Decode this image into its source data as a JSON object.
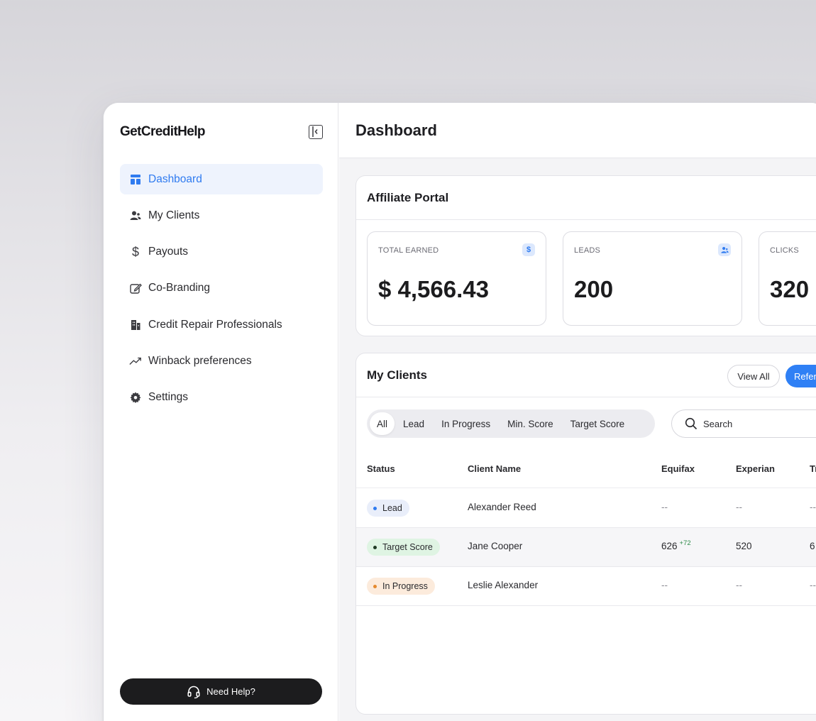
{
  "sidebar": {
    "logo": "GetCreditHelp",
    "items": [
      {
        "label": "Dashboard",
        "icon": "dashboard-icon",
        "active": true
      },
      {
        "label": "My Clients",
        "icon": "users-icon"
      },
      {
        "label": "Payouts",
        "icon": "dollar-icon"
      },
      {
        "label": "Co-Branding",
        "icon": "edit-icon"
      },
      {
        "label": "Credit Repair Professionals",
        "icon": "building-icon"
      },
      {
        "label": "Winback preferences",
        "icon": "trending-up-icon"
      },
      {
        "label": "Settings",
        "icon": "gear-icon"
      }
    ],
    "help_label": "Need Help?"
  },
  "header": {
    "title": "Dashboard"
  },
  "affiliate": {
    "title": "Affiliate Portal",
    "stats": [
      {
        "label": "TOTAL EARNED",
        "value": "$ 4,566.43",
        "icon": "$"
      },
      {
        "label": "LEADS",
        "value": "200"
      },
      {
        "label": "CLICKS",
        "value": "320"
      }
    ]
  },
  "clients": {
    "title": "My Clients",
    "view_all": "View All",
    "refer_label": "Refer",
    "filters": [
      "All",
      "Lead",
      "In Progress",
      "Min. Score",
      "Target Score"
    ],
    "search_placeholder": "Search",
    "columns": [
      "Status",
      "Client Name",
      "Equifax",
      "Experian",
      "Tr"
    ],
    "rows": [
      {
        "status": "Lead",
        "name": "Alexander Reed",
        "equifax": "--",
        "equifax_delta": "",
        "experian": "--",
        "transunion": "--"
      },
      {
        "status": "Target Score",
        "name": "Jane Cooper",
        "equifax": "626",
        "equifax_delta": "+72",
        "experian": "520",
        "transunion": "6"
      },
      {
        "status": "In Progress",
        "name": "Leslie Alexander",
        "equifax": "--",
        "equifax_delta": "",
        "experian": "--",
        "transunion": "--"
      }
    ]
  },
  "colors": {
    "accent": "#2f7bf0",
    "button_primary": "#2f80f5",
    "dark_button": "#1c1c1e"
  }
}
